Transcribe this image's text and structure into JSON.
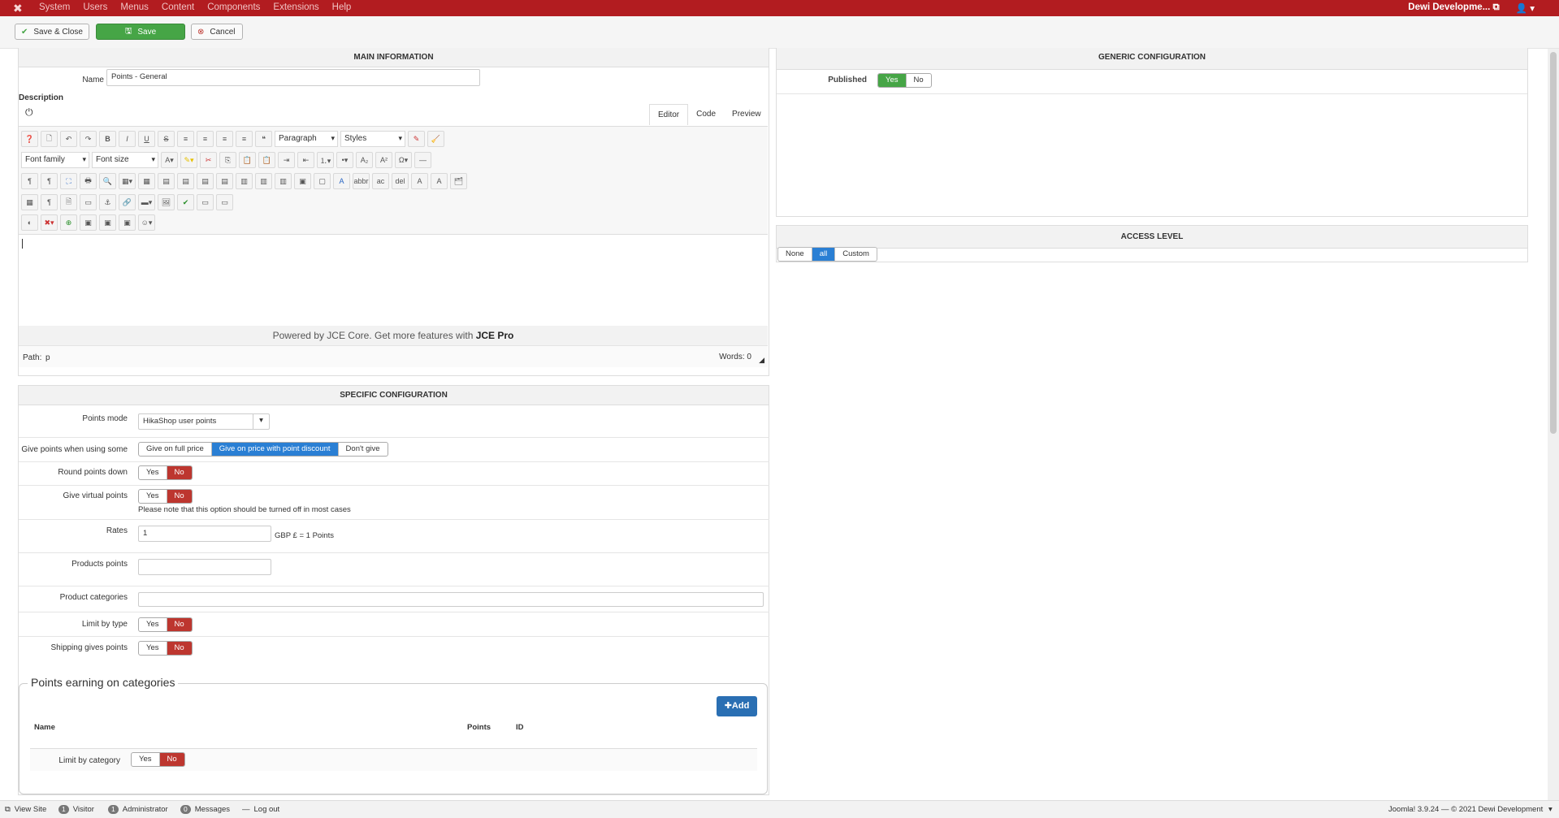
{
  "topbar": {
    "menu": [
      "System",
      "Users",
      "Menus",
      "Content",
      "Components",
      "Extensions",
      "Help"
    ],
    "user": "Dewi Developme...",
    "user_icon": "external-link-icon"
  },
  "toolbar": {
    "save_close": "Save & Close",
    "save": "Save",
    "cancel": "Cancel"
  },
  "main": {
    "title": "MAIN INFORMATION",
    "name_label": "Name",
    "name_value": "Points - General",
    "description_label": "Description",
    "editor_tabs": [
      "Editor",
      "Code",
      "Preview"
    ],
    "paragraph": "Paragraph",
    "styles": "Styles",
    "font_family": "Font family",
    "font_size": "Font size",
    "powered_prefix": "Powered by JCE Core. Get more features with ",
    "powered_link": "JCE Pro",
    "path_label": "Path:",
    "path_value": "p",
    "words": "Words: 0"
  },
  "generic": {
    "title": "GENERIC CONFIGURATION",
    "published_label": "Published",
    "yes": "Yes",
    "no": "No"
  },
  "access": {
    "title": "ACCESS LEVEL",
    "options": [
      "None",
      "all",
      "Custom"
    ]
  },
  "specific": {
    "title": "SPECIFIC CONFIGURATION",
    "points_mode_label": "Points mode",
    "points_mode_value": "HikaShop user points",
    "give_points_label": "Give points when using some",
    "give_options": [
      "Give on full price",
      "Give on price with point discount",
      "Don't give"
    ],
    "round_label": "Round points down",
    "virtual_label": "Give virtual points",
    "virtual_note": "Please note that this option should be turned off in most cases",
    "rates_label": "Rates",
    "rates_value": "1",
    "rates_suffix": "GBP £ = 1 Points",
    "products_label": "Products points",
    "categories_label": "Product categories",
    "limit_type_label": "Limit by type",
    "shipping_label": "Shipping gives points",
    "yes": "Yes",
    "no": "No"
  },
  "categories": {
    "legend": "Points earning on categories",
    "add": "Add",
    "col_name": "Name",
    "col_points": "Points",
    "col_id": "ID",
    "limit_label": "Limit by category"
  },
  "footer": {
    "view_site": "View Site",
    "visitor_count": "1",
    "visitor": "Visitor",
    "admin_count": "1",
    "admin": "Administrator",
    "msg_count": "0",
    "messages": "Messages",
    "logout": "Log out",
    "version": "Joomla! 3.9.24 — © 2021 Dewi Development"
  }
}
